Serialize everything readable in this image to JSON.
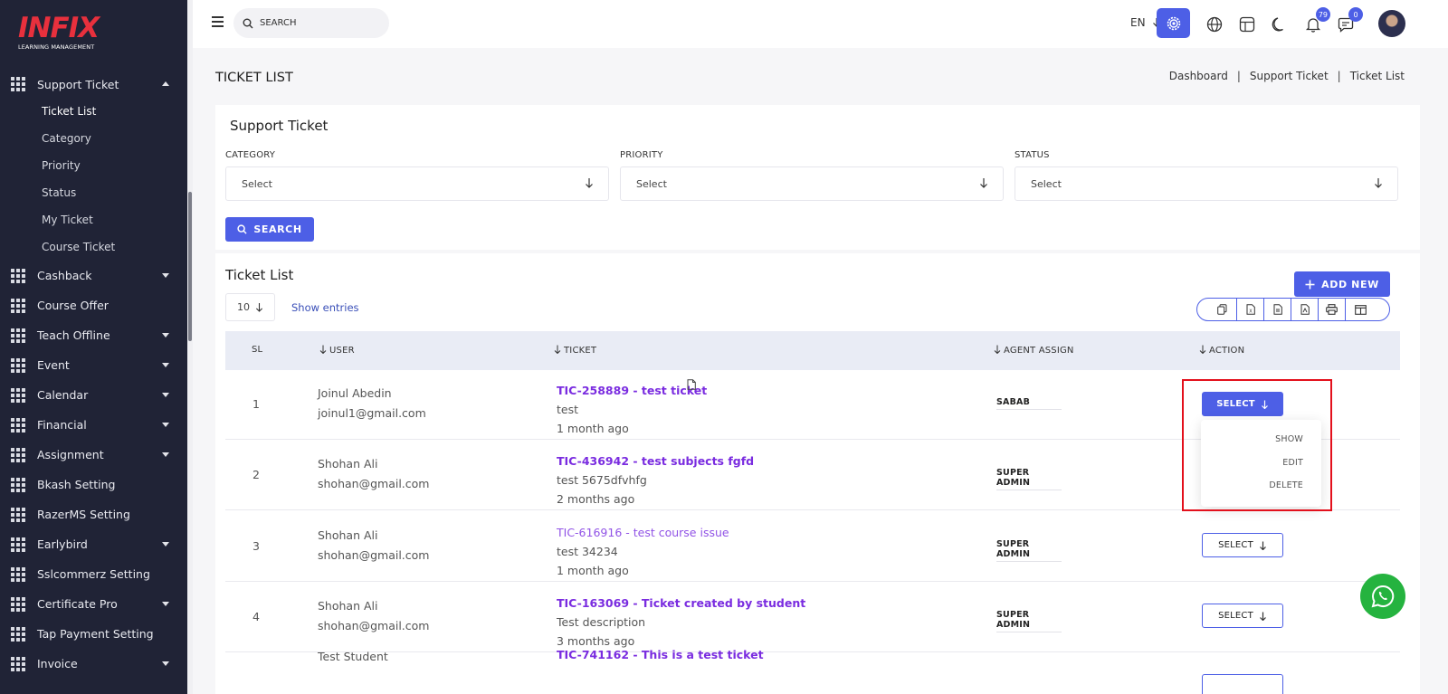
{
  "logo": {
    "name": "INFIX",
    "tagline": "LEARNING MANAGEMENT"
  },
  "sidebar": {
    "items": [
      {
        "label": "Support Ticket",
        "expanded": true,
        "has_caret": true,
        "children": [
          "Ticket List",
          "Category",
          "Priority",
          "Status",
          "My Ticket",
          "Course Ticket"
        ]
      },
      {
        "label": "Cashback",
        "has_caret": true
      },
      {
        "label": "Course Offer",
        "has_caret": false
      },
      {
        "label": "Teach Offline",
        "has_caret": true
      },
      {
        "label": "Event",
        "has_caret": true
      },
      {
        "label": "Calendar",
        "has_caret": true
      },
      {
        "label": "Financial",
        "has_caret": true
      },
      {
        "label": "Assignment",
        "has_caret": true
      },
      {
        "label": "Bkash Setting",
        "has_caret": false
      },
      {
        "label": "RazerMS Setting",
        "has_caret": false
      },
      {
        "label": "Earlybird",
        "has_caret": true
      },
      {
        "label": "Sslcommerz Setting",
        "has_caret": false
      },
      {
        "label": "Certificate Pro",
        "has_caret": true
      },
      {
        "label": "Tap Payment Setting",
        "has_caret": false
      },
      {
        "label": "Invoice",
        "has_caret": true
      }
    ]
  },
  "topbar": {
    "search_placeholder": "SEARCH",
    "language": "EN",
    "notifications_count": "79",
    "messages_count": "0",
    "icons": [
      "menu-icon",
      "search-icon",
      "gear-icon",
      "globe-icon",
      "layout-icon",
      "moon-icon",
      "bell-icon",
      "chat-icon"
    ]
  },
  "page": {
    "title": "TICKET LIST",
    "breadcrumb": [
      "Dashboard",
      "Support Ticket",
      "Ticket List"
    ]
  },
  "filter": {
    "title": "Support Ticket",
    "category_label": "CATEGORY",
    "category_value": "Select",
    "priority_label": "PRIORITY",
    "priority_value": "Select",
    "status_label": "STATUS",
    "status_value": "Select",
    "search_button": "SEARCH"
  },
  "list": {
    "title": "Ticket List",
    "add_button": "ADD NEW",
    "entries_value": "10",
    "show_entries": "Show entries",
    "export_icons": [
      "copy-icon",
      "excel-icon",
      "csv-icon",
      "pdf-icon",
      "print-icon",
      "columns-icon"
    ],
    "headers": {
      "sl": "SL",
      "user": "USER",
      "ticket": "TICKET",
      "agent": "AGENT ASSIGN",
      "action": "ACTION"
    },
    "action_label": "SELECT",
    "rows": [
      {
        "sl": "1",
        "name": "Joinul Abedin",
        "email": "joinul1@gmail.com",
        "ticket": "TIC-258889 - test ticket",
        "desc": "test",
        "time": "1 month ago",
        "agent": "SABAB",
        "has_attachment": true,
        "title_style": "bold"
      },
      {
        "sl": "2",
        "name": "Shohan Ali",
        "email": "shohan@gmail.com",
        "ticket": "TIC-436942 - test subjects fgfd",
        "desc": "test 5675dfvhfg",
        "time": "2 months ago",
        "agent": "SUPER ADMIN",
        "title_style": "bold"
      },
      {
        "sl": "3",
        "name": "Shohan Ali",
        "email": "shohan@gmail.com",
        "ticket": "TIC-616916 - test course issue",
        "desc": "test 34234",
        "time": "1 month ago",
        "agent": "SUPER ADMIN",
        "title_style": "light"
      },
      {
        "sl": "4",
        "name": "Shohan Ali",
        "email": "shohan@gmail.com",
        "ticket": "TIC-163069 - Ticket created by student",
        "desc": "Test description",
        "time": "3 months ago",
        "agent": "SUPER ADMIN",
        "title_style": "bold"
      },
      {
        "sl": "",
        "name": "Test Student",
        "email": "",
        "ticket": "TIC-741162 - This is a test ticket",
        "desc": "",
        "time": "",
        "agent": "",
        "title_style": "bold"
      }
    ],
    "dropdown": [
      "SHOW",
      "EDIT",
      "DELETE"
    ]
  },
  "colors": {
    "primary": "#4d5fe6",
    "sidebar": "#202336",
    "ticket_link": "#7a2ce0",
    "highlight": "#e3101c",
    "whatsapp": "#25b33f"
  }
}
